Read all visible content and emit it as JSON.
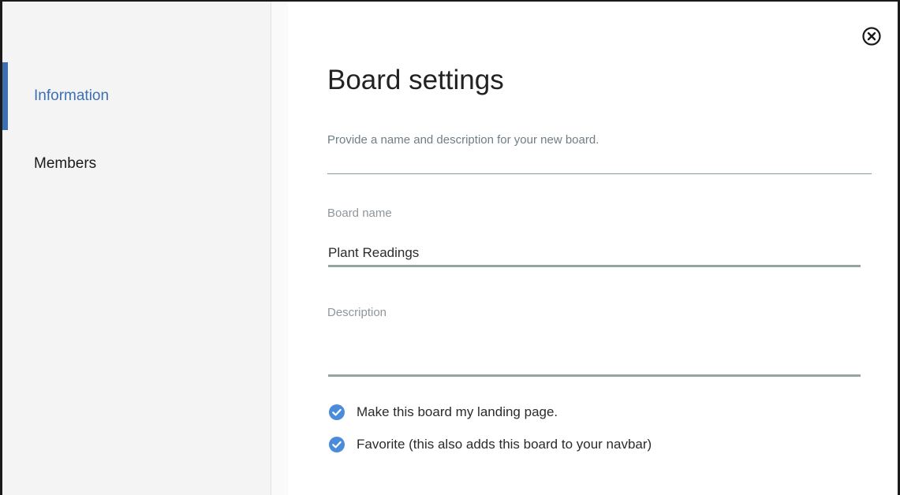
{
  "sidebar": {
    "items": [
      {
        "label": "Information",
        "active": true
      },
      {
        "label": "Members",
        "active": false
      }
    ]
  },
  "dialog": {
    "close_icon": "close-circle-icon",
    "title": "Board settings",
    "subtitle": "Provide a name and description for your new board.",
    "fields": {
      "board_name": {
        "label": "Board name",
        "value": "Plant Readings"
      },
      "description": {
        "label": "Description",
        "value": ""
      }
    },
    "options": [
      {
        "label": "Make this board my landing page.",
        "checked": true
      },
      {
        "label": "Favorite (this also adds this board to your navbar)",
        "checked": true
      }
    ]
  },
  "colors": {
    "accent": "#3d70b2",
    "checkbox": "#4a8bdc",
    "sidebar_bg": "#f4f4f4",
    "input_underline": "#95a5a2"
  }
}
